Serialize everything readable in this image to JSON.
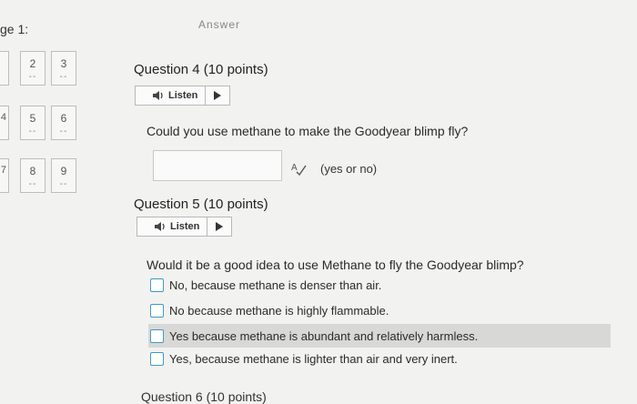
{
  "page": {
    "label": "ge 1:",
    "answer_heading": "Answer"
  },
  "nav": {
    "tiles": [
      {
        "number": "2",
        "status": "--"
      },
      {
        "number": "3",
        "status": "--"
      },
      {
        "number": "5",
        "status": "--"
      },
      {
        "number": "6",
        "status": "--"
      },
      {
        "number": "8",
        "status": "--"
      },
      {
        "number": "9",
        "status": "--"
      }
    ],
    "edge_tiles": [
      {
        "number": ""
      },
      {
        "number": "4"
      },
      {
        "number": "7"
      }
    ]
  },
  "question4": {
    "title": "Question 4",
    "points": "(10 points)",
    "listen_label": "Listen",
    "text": "Could you use methane to make the Goodyear blimp fly?",
    "input_value": "",
    "hint": "(yes or no)"
  },
  "question5": {
    "title": "Question 5",
    "points": "(10 points)",
    "listen_label": "Listen",
    "text": "Would it be a good idea to use Methane to fly the Goodyear blimp?",
    "options": [
      "No, because methane is denser than air.",
      "No because methane is highly flammable.",
      "Yes because methane is abundant and relatively harmless.",
      "Yes, because methane is lighter than air and very inert."
    ]
  },
  "question6": {
    "title": "Question 6",
    "points": "(10 points)"
  },
  "colors": {
    "checkbox_border": "#3a9cc9",
    "highlight_row": "#d8d8d6"
  }
}
